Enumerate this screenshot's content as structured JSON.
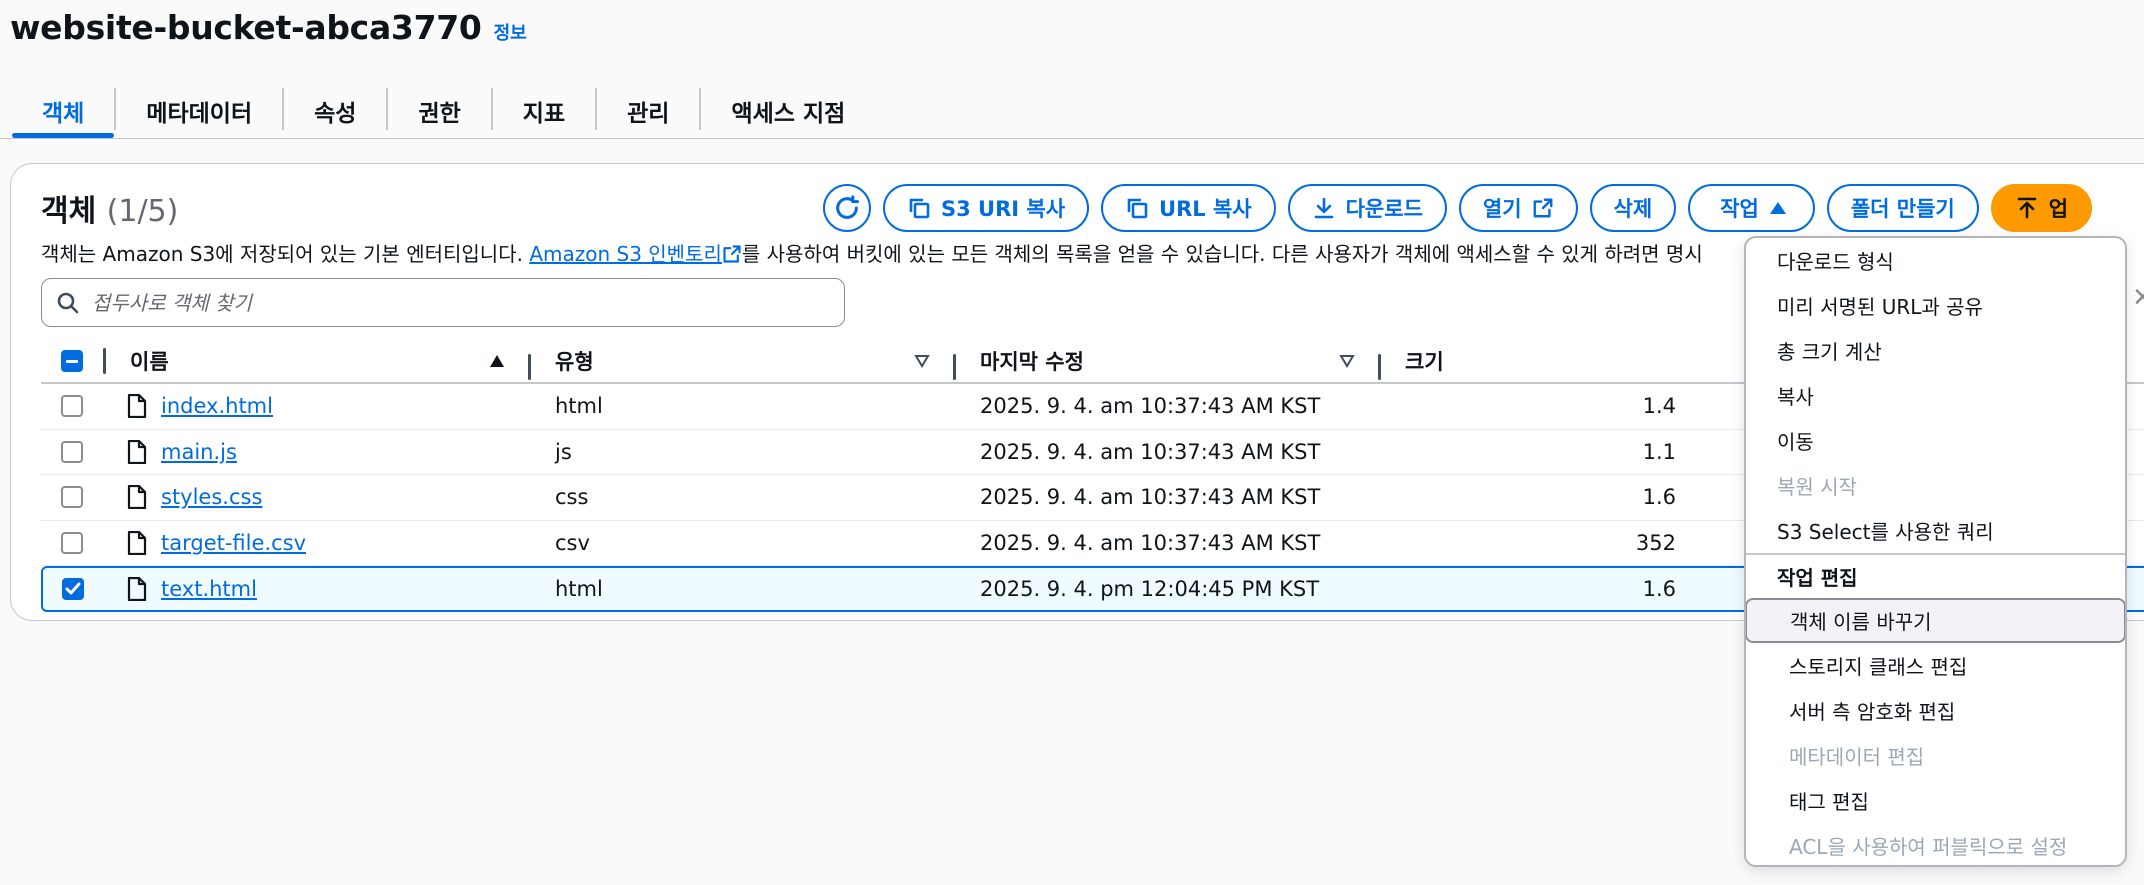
{
  "header": {
    "title": "website-bucket-abca3770",
    "info_link": "정보"
  },
  "tabs": [
    {
      "label": "객체",
      "active": true
    },
    {
      "label": "메타데이터"
    },
    {
      "label": "속성"
    },
    {
      "label": "권한"
    },
    {
      "label": "지표"
    },
    {
      "label": "관리"
    },
    {
      "label": "액세스 지점"
    }
  ],
  "objects": {
    "title": "객체",
    "count": "(1/5)",
    "desc_before": "객체는 Amazon S3에 저장되어 있는 기본 엔터티입니다. ",
    "desc_link": "Amazon S3 인벤토리",
    "desc_after": "를 사용하여 버킷에 있는 모든 객체의 목록을 얻을 수 있습니다. 다른 사용자가 객체에 액세스할 수 있게 하려면 명시",
    "search_placeholder": "접두사로 객체 찾기"
  },
  "toolbar": {
    "copy_s3_uri": "S3 URI 복사",
    "copy_url": "URL 복사",
    "download": "다운로드",
    "open": "열기",
    "delete": "삭제",
    "actions": "작업",
    "create_folder": "폴더 만들기",
    "upload": "업"
  },
  "table": {
    "headers": {
      "name": "이름",
      "type": "유형",
      "modified": "마지막 수정",
      "size": "크기"
    },
    "rows": [
      {
        "name": "index.html",
        "type": "html",
        "modified": "2025. 9. 4. am 10:37:43 AM KST",
        "size": "1.4",
        "checked": false
      },
      {
        "name": "main.js",
        "type": "js",
        "modified": "2025. 9. 4. am 10:37:43 AM KST",
        "size": "1.1",
        "checked": false
      },
      {
        "name": "styles.css",
        "type": "css",
        "modified": "2025. 9. 4. am 10:37:43 AM KST",
        "size": "1.6",
        "checked": false
      },
      {
        "name": "target-file.csv",
        "type": "csv",
        "modified": "2025. 9. 4. am 10:37:43 AM KST",
        "size": "352",
        "checked": false
      },
      {
        "name": "text.html",
        "type": "html",
        "modified": "2025. 9. 4. pm 12:04:45 PM KST",
        "size": "1.6",
        "checked": true
      }
    ]
  },
  "menu": {
    "items": [
      {
        "label": "다운로드 형식"
      },
      {
        "label": "미리 서명된 URL과 공유"
      },
      {
        "label": "총 크기 계산"
      },
      {
        "label": "복사"
      },
      {
        "label": "이동"
      },
      {
        "label": "복원 시작",
        "disabled": true
      },
      {
        "label": "S3 Select를 사용한 쿼리"
      }
    ],
    "group_label": "작업 편집",
    "group_items": [
      {
        "label": "객체 이름 바꾸기",
        "hovered": true
      },
      {
        "label": "스토리지 클래스 편집"
      },
      {
        "label": "서버 측 암호화 편집"
      },
      {
        "label": "메타데이터 편집",
        "disabled": true
      },
      {
        "label": "태그 편집"
      },
      {
        "label": "ACL을 사용하여 퍼블릭으로 설정",
        "disabled": true
      }
    ]
  }
}
